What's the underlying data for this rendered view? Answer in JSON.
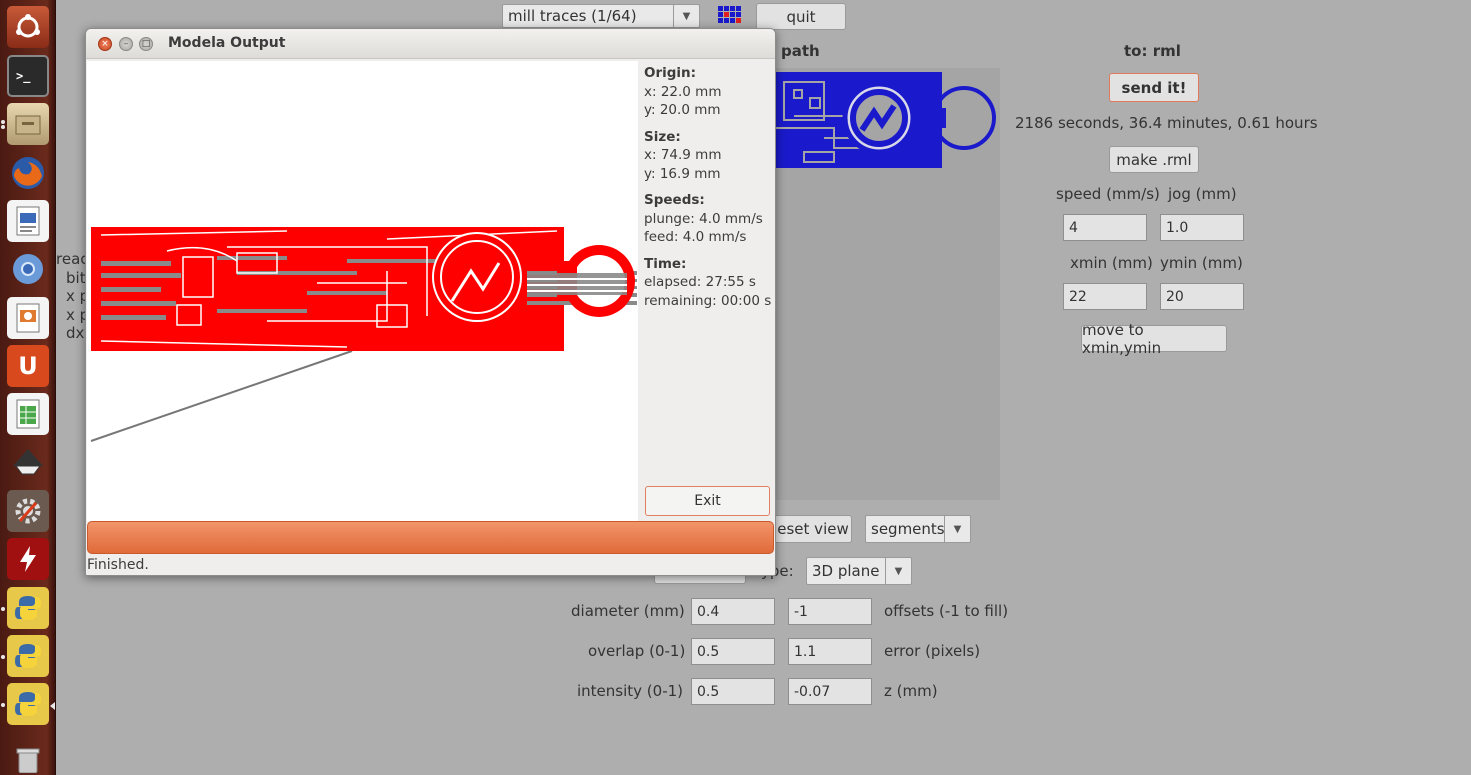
{
  "background_app": {
    "top_controls": {
      "process_select": "mill traces (1/64)",
      "quit_label": "quit"
    },
    "toolpath_heading": "path",
    "output_heading": "to: rml",
    "send_label": "send it!",
    "time_estimate": "2186 seconds, 36.4 minutes, 0.61 hours",
    "make_rml_label": "make .rml",
    "speed_label": "speed (mm/s)",
    "jog_label": "jog (mm)",
    "speed_value": "4",
    "jog_value": "1.0",
    "xmin_label": "xmin (mm)",
    "ymin_label": "ymin (mm)",
    "xmin_value": "22",
    "ymin_value": "20",
    "move_label": "move to xmin,ymin",
    "reset_view_label": "eset view",
    "segments_select": "segments",
    "type_label": "ype:",
    "plane_select": "3D plane",
    "diameter_label": "diameter (mm)",
    "diameter_value": "0.4",
    "offsets_value": "-1",
    "offsets_label": "offsets (-1 to fill)",
    "overlap_label": "overlap (0-1)",
    "overlap_value": "0.5",
    "error_value": "1.1",
    "error_label": "error (pixels)",
    "intensity_label": "intensity (0-1)",
    "intensity_value": "0.5",
    "z_value": "-0.07",
    "z_label": "z (mm)",
    "left_clip_lines": [
      "reac",
      "bit",
      "x p",
      "x p",
      "dx"
    ]
  },
  "modal": {
    "title": "Modela Output",
    "origin_heading": "Origin:",
    "origin_x": "x: 22.0 mm",
    "origin_y": "y: 20.0 mm",
    "size_heading": "Size:",
    "size_x": "x: 74.9 mm",
    "size_y": "y: 16.9 mm",
    "speeds_heading": "Speeds:",
    "plunge": "plunge: 4.0 mm/s",
    "feed": "feed: 4.0 mm/s",
    "time_heading": "Time:",
    "elapsed": "elapsed: 27:55 s",
    "remaining": "remaining: 00:00 s",
    "exit_label": "Exit",
    "progress_fraction": 1.0,
    "status": "Finished."
  },
  "launcher": {
    "icons": [
      "dash-icon",
      "terminal-icon",
      "files-icon",
      "firefox-icon",
      "writer-icon",
      "chromium-icon",
      "impress-icon",
      "ubuntu-one-icon",
      "calc-icon",
      "inkscape-icon",
      "settings-icon",
      "flash-icon",
      "python-icon",
      "python-icon",
      "python-icon",
      "trash-icon"
    ]
  },
  "colors": {
    "toolpath_red": "#ff0000",
    "preview_blue": "#1a1acc",
    "progress": "#e8743f",
    "desktop_bg": "#aeaeae"
  }
}
